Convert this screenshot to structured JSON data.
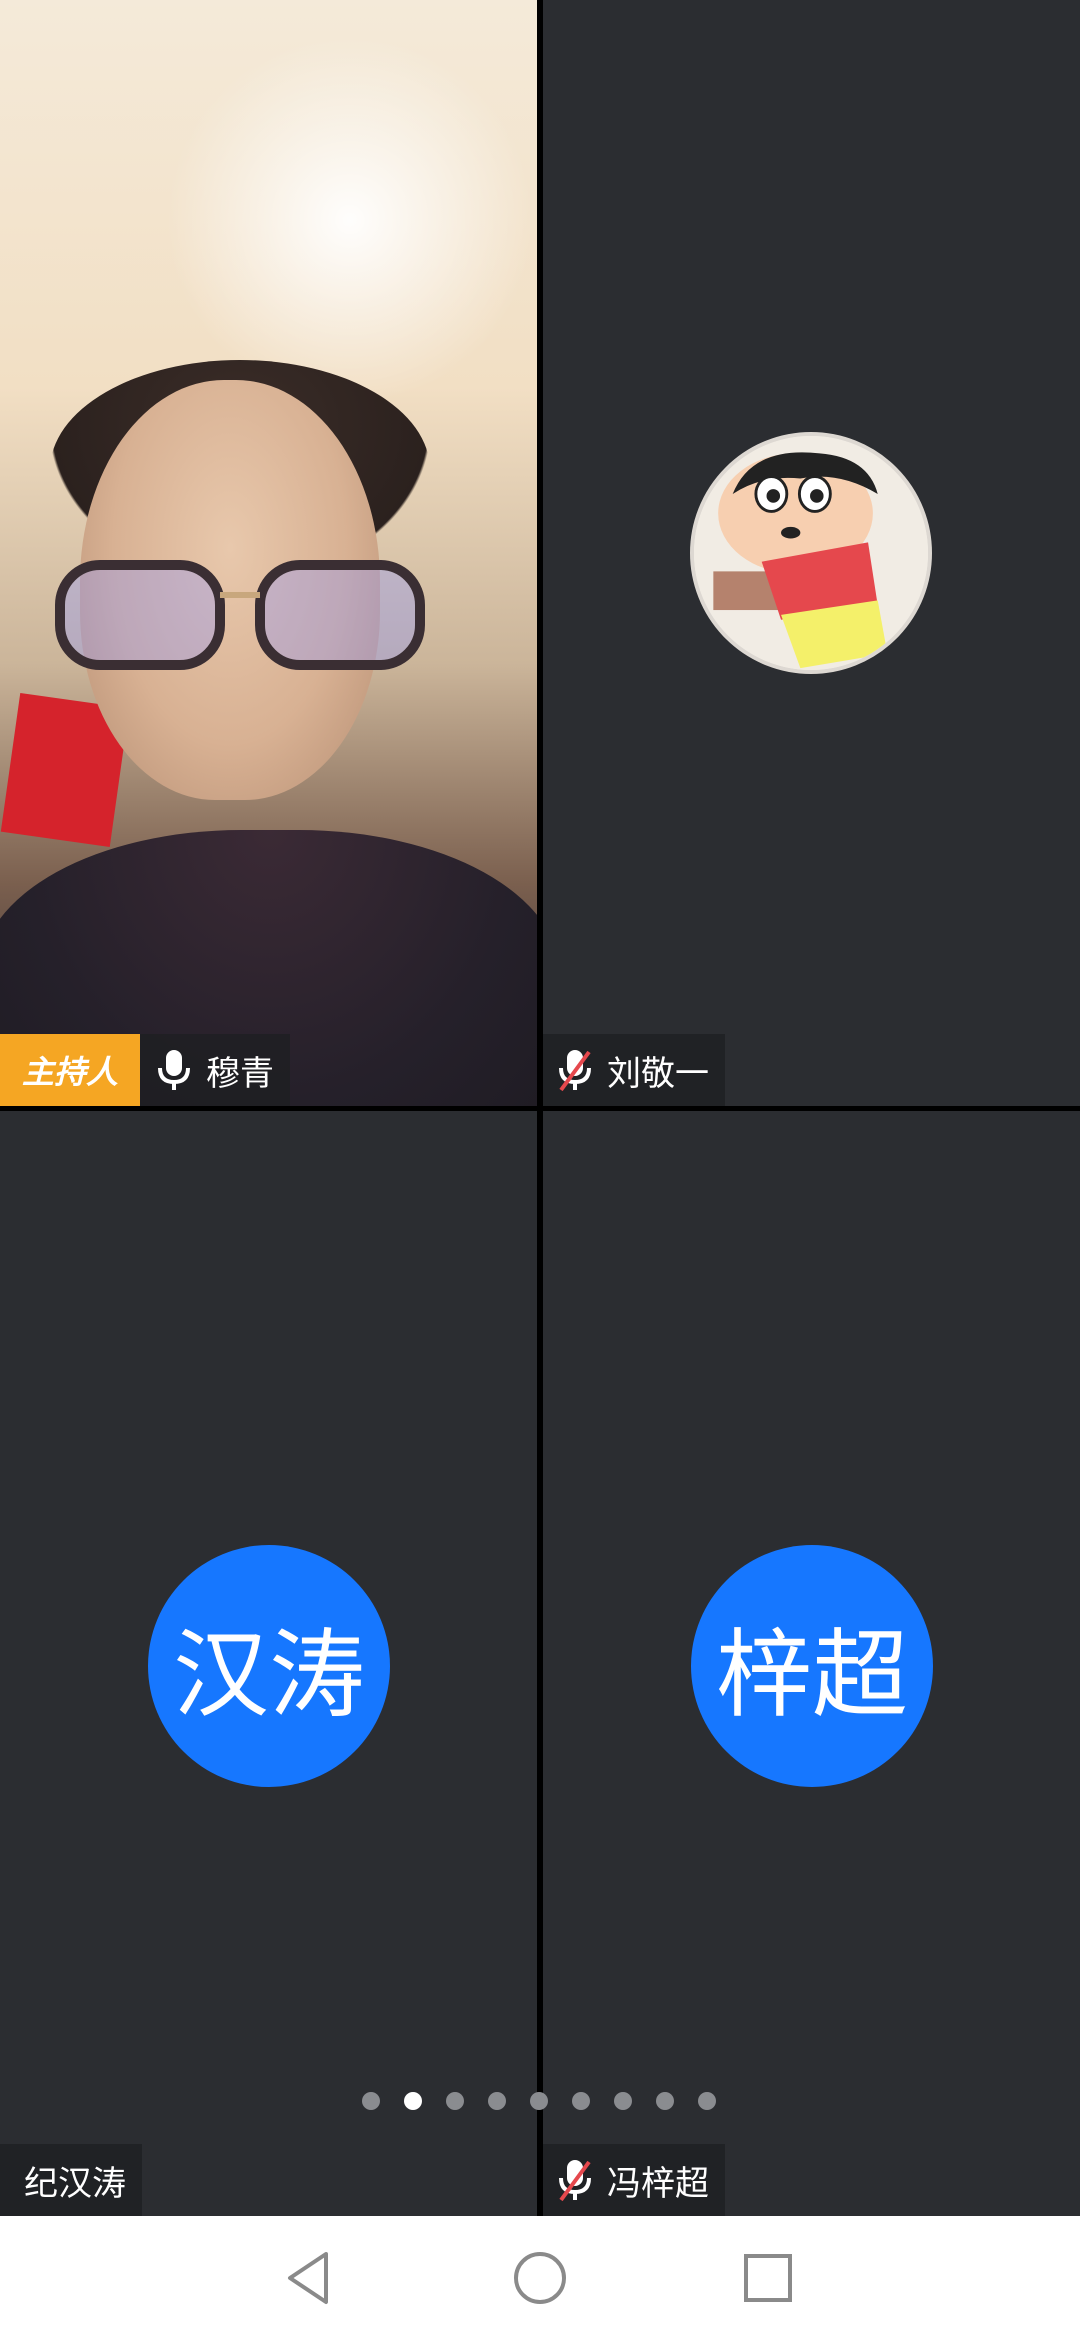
{
  "participants": [
    {
      "id": "host",
      "name": "穆青",
      "role_badge": "主持人",
      "mic": "on",
      "video": "camera"
    },
    {
      "id": "liu",
      "name": "刘敬一",
      "mic": "muted",
      "video": "avatar-image",
      "avatar_icon": "cartoon-boy-avatar"
    },
    {
      "id": "han",
      "name": "纪汉涛",
      "avatar_text": "汉涛",
      "video": "avatar-text"
    },
    {
      "id": "zi",
      "name": "冯梓超",
      "mic": "muted",
      "avatar_text": "梓超",
      "video": "avatar-text"
    }
  ],
  "pager": {
    "total": 9,
    "current": 2
  },
  "colors": {
    "tile_bg": "#2b2d31",
    "avatar_blue": "#1677ff",
    "host_badge": "#f5a623",
    "muted_red": "#e5484d"
  },
  "navbar": {
    "icons": [
      "back-triangle-icon",
      "home-circle-icon",
      "recents-square-icon"
    ]
  }
}
